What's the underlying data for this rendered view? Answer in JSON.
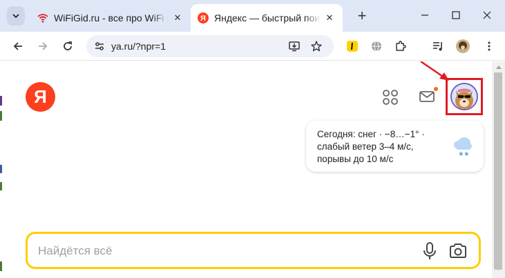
{
  "browser": {
    "tabs": [
      {
        "title": "WiFiGid.ru - все про WiFi и бе",
        "active": false
      },
      {
        "title": "Яндекс — быстрый поиск в и",
        "active": true
      }
    ],
    "new_tab_label": "+",
    "address_bar": {
      "url": "ya.ru/?npr=1"
    },
    "accent_color": "#dfe7f6"
  },
  "page": {
    "logo_letter": "Я",
    "weather": {
      "text": "Сегодня: снег · −8…−1° · слабый ветер 3–4 м/с, порывы до 10 м/с",
      "icon": "snow-cloud-icon"
    },
    "search": {
      "placeholder": "Найдётся всё"
    },
    "brand_color": "#fc3f1d",
    "search_border_color": "#ffcc00",
    "highlight_color": "#e01b23"
  }
}
